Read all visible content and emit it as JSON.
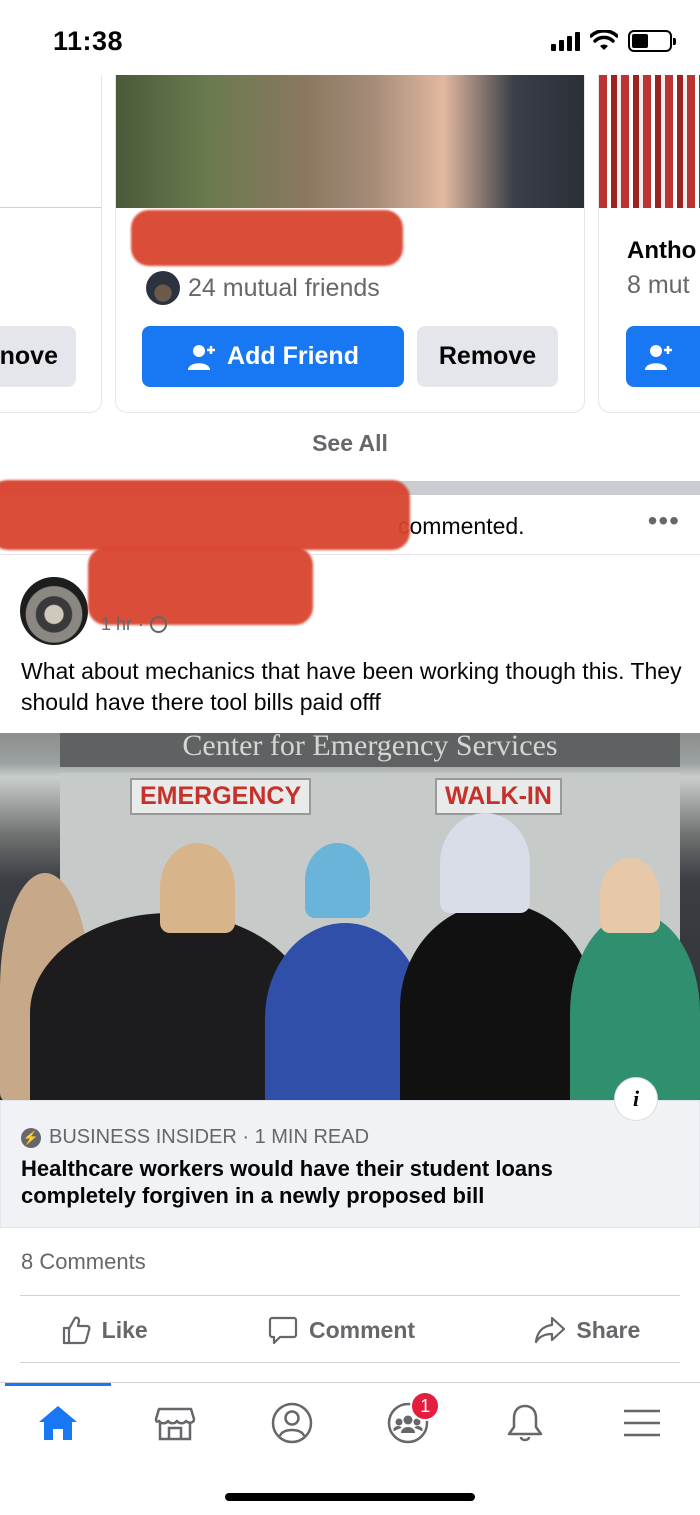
{
  "status_bar": {
    "time": "11:38",
    "battery_level": 0.45
  },
  "people_you_may_know": {
    "left_card": {
      "button_label": "nove"
    },
    "main_card": {
      "name": "",
      "mutual_friends": "24 mutual friends",
      "add_friend_label": "Add Friend",
      "remove_label": "Remove"
    },
    "right_card": {
      "name": "Antho",
      "mutual_friends": "8 mut"
    },
    "see_all_label": "See All"
  },
  "post": {
    "activity_text": "commented.",
    "more_label": "•••",
    "time": "1 hr",
    "text": "What about mechanics that have been working though this. They should have there tool bills paid offf",
    "link_preview": {
      "image_signs": {
        "top": "Center for Emergency Services",
        "emergency": "EMERGENCY",
        "walkin": "WALK-IN"
      },
      "info_label": "i",
      "source": "BUSINESS INSIDER · 1 MIN READ",
      "title": "Healthcare workers would have their student loans completely forgiven in a newly proposed bill"
    },
    "comments_count": "8 Comments",
    "actions": {
      "like": "Like",
      "comment": "Comment",
      "share": "Share"
    }
  },
  "tab_bar": {
    "items": [
      "home-icon",
      "marketplace-icon",
      "profile-icon",
      "groups-icon",
      "notifications-icon",
      "menu-icon"
    ],
    "groups_badge": "1",
    "active_color": "#1877f2"
  }
}
